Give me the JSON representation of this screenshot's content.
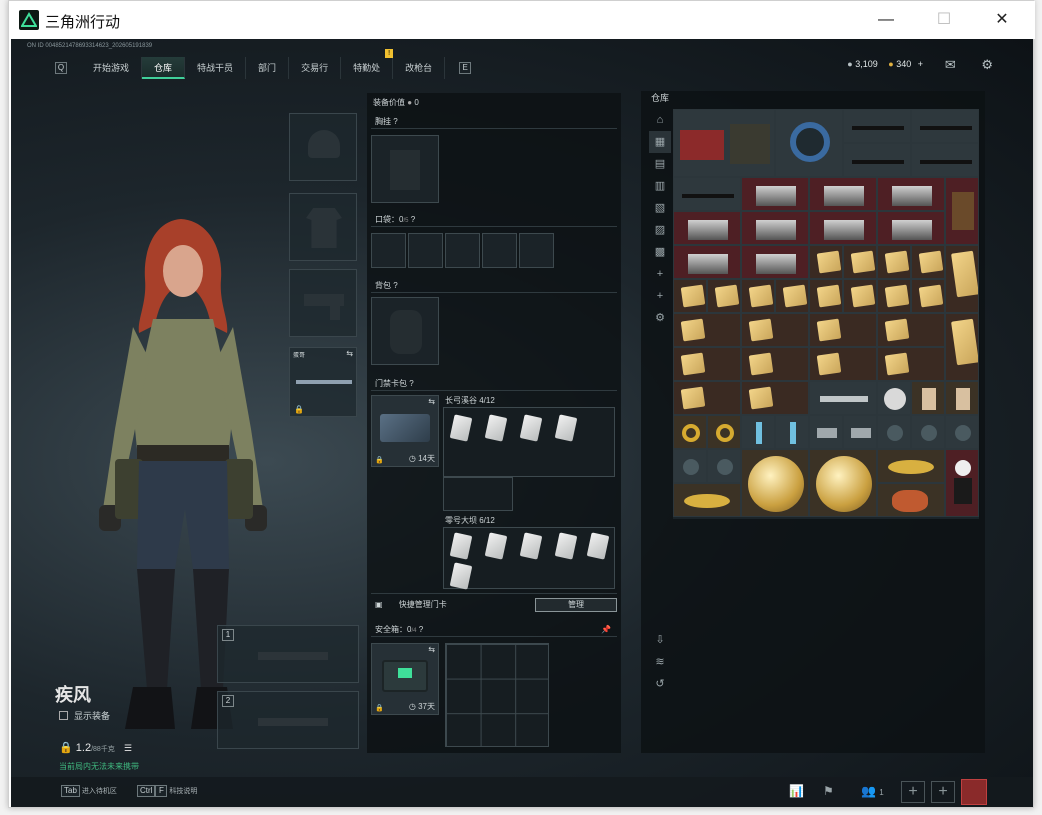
{
  "window": {
    "title": "三角洲行动",
    "minimize": "—",
    "maximize": "☐",
    "close": "✕"
  },
  "account_id": "ON ID 0048521478693314623_202605191839",
  "nav": {
    "left_key": "Q",
    "right_key": "E",
    "tabs": [
      "开始游戏",
      "仓库",
      "特战干员",
      "部门",
      "交易行",
      "特勤处",
      "改枪台"
    ],
    "active": "仓库",
    "badge": "!"
  },
  "currency": {
    "coins": "3,109",
    "points": "340",
    "plus": "+"
  },
  "character": {
    "name": "疾风",
    "show_equip": "显示装备",
    "weight": "1.2",
    "weight_max": "/88千克",
    "hint": "当前局内无法未来携带"
  },
  "left_slots": {
    "slot4_label": "蛋哥",
    "weapon1": "1",
    "weapon2": "2"
  },
  "mid": {
    "value_label": "装备价值",
    "value": "0",
    "chest": "胸挂",
    "pocket": "口袋：",
    "pocket_count": "0",
    "pocket_unit": "/5",
    "backpack": "背包",
    "keycard_bag": "门禁卡包",
    "group1_name": "长弓溪谷",
    "group1_count": "4/12",
    "group2_name": "零号大坝",
    "group2_count": "6/12",
    "keycard_days": "14天",
    "manage_label": "快捷管理门卡",
    "manage_btn": "管理",
    "safebox": "安全箱：",
    "safebox_count": "0",
    "safebox_unit": "/4",
    "safebox_days": "37天"
  },
  "stash": {
    "title": "仓库"
  },
  "bottom": {
    "tab_key": "Tab",
    "tab_label": "进入待机区",
    "ctrl_key": "Ctrl",
    "f_key": "F",
    "ctrl_label": "科技说明",
    "party_count": "1"
  }
}
